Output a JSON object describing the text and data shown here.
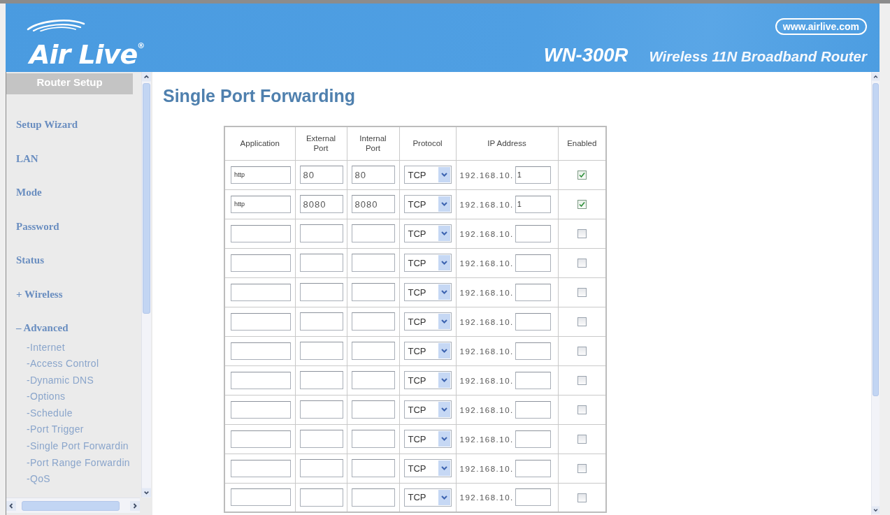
{
  "header": {
    "logo": "Air Live$^{®}$",
    "website": "www.airlive.com",
    "model": "WN-300R",
    "product": "Wireless 11N Broadband Router"
  },
  "sidebar": {
    "title": "Router Setup",
    "items": [
      {
        "label": "Setup Wizard"
      },
      {
        "label": "LAN"
      },
      {
        "label": "Mode"
      },
      {
        "label": "Password"
      },
      {
        "label": "Status"
      },
      {
        "label": "+ Wireless"
      },
      {
        "label": "– Advanced",
        "children": [
          {
            "label": "-Internet"
          },
          {
            "label": "-Access Control"
          },
          {
            "label": "-Dynamic DNS"
          },
          {
            "label": "-Options"
          },
          {
            "label": "-Schedule"
          },
          {
            "label": "-Port Trigger"
          },
          {
            "label": "-Single Port Forwardin"
          },
          {
            "label": "-Port Range Forwardin"
          },
          {
            "label": "-QoS"
          }
        ]
      }
    ]
  },
  "page": {
    "title": "Single Port Forwarding"
  },
  "table": {
    "columns": [
      "Application",
      "External Port",
      "Internal Port",
      "Protocol",
      "IP Address",
      "Enabled"
    ],
    "rows": [
      {
        "application": "http",
        "external_port": "80",
        "internal_port": "80",
        "protocol": "TCP",
        "ip_prefix": "192.168.10.",
        "ip_host": "1",
        "enabled": true
      },
      {
        "application": "http",
        "external_port": "8080",
        "internal_port": "8080",
        "protocol": "TCP",
        "ip_prefix": "192.168.10.",
        "ip_host": "1",
        "enabled": true
      },
      {
        "protocol": "TCP",
        "ip_prefix": "192.168.10.",
        "enabled": false
      },
      {
        "protocol": "TCP",
        "ip_prefix": "192.168.10.",
        "enabled": false
      },
      {
        "protocol": "TCP",
        "ip_prefix": "192.168.10.",
        "enabled": false
      },
      {
        "protocol": "TCP",
        "ip_prefix": "192.168.10.",
        "enabled": false
      },
      {
        "protocol": "TCP",
        "ip_prefix": "192.168.10.",
        "enabled": false
      },
      {
        "protocol": "TCP",
        "ip_prefix": "192.168.10.",
        "enabled": false
      },
      {
        "protocol": "TCP",
        "ip_prefix": "192.168.10.",
        "enabled": false
      },
      {
        "protocol": "TCP",
        "ip_prefix": "192.168.10.",
        "enabled": false
      },
      {
        "protocol": "TCP",
        "ip_prefix": "192.168.10.",
        "enabled": false
      },
      {
        "protocol": "TCP",
        "ip_prefix": "192.168.10.",
        "enabled": false
      }
    ]
  }
}
